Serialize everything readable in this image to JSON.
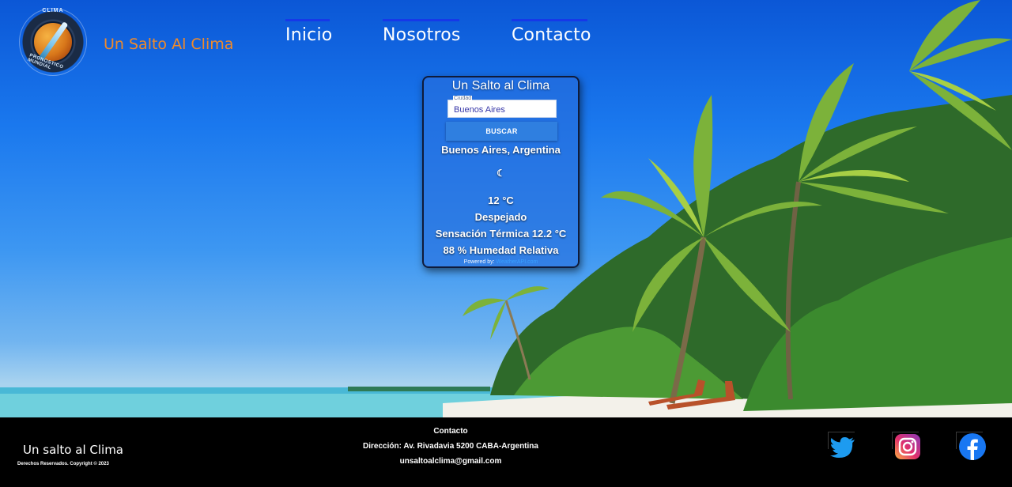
{
  "header": {
    "logo": {
      "top_text": "CLIMA",
      "bottom_text": "PRONOSTICO MUNDIAL"
    },
    "brand": "Un Salto Al Clima",
    "nav": [
      {
        "label": "Inicio"
      },
      {
        "label": "Nosotros"
      },
      {
        "label": "Contacto"
      }
    ]
  },
  "weather_card": {
    "title": "Un Salto al Clima",
    "city_label": "Ciudad",
    "city_value": "Buenos Aires",
    "search_button": "BUSCAR",
    "location": "Buenos Aires, Argentina",
    "condition_icon": "moon-icon",
    "temperature": "12 °C",
    "condition": "Despejado",
    "feels_like": "Sensación Térmica 12.2 °C",
    "humidity": "88 % Humedad Relativa",
    "powered_prefix": "Powered by:",
    "powered_link": "WeatherAPI.com"
  },
  "footer": {
    "brand": "Un salto al Clima",
    "copyright": "Derechos Reservados. Copyright © 2023",
    "contact_title": "Contacto",
    "address": "Dirección: Av. Rivadavia 5200 CABA-Argentina",
    "email": "unsaltoalclima@gmail.com",
    "social": [
      {
        "icon": "twitter-icon",
        "color": "#1d9bf0"
      },
      {
        "icon": "instagram-icon",
        "color": "#e1306c"
      },
      {
        "icon": "facebook-icon",
        "color": "#1877f2"
      }
    ]
  }
}
